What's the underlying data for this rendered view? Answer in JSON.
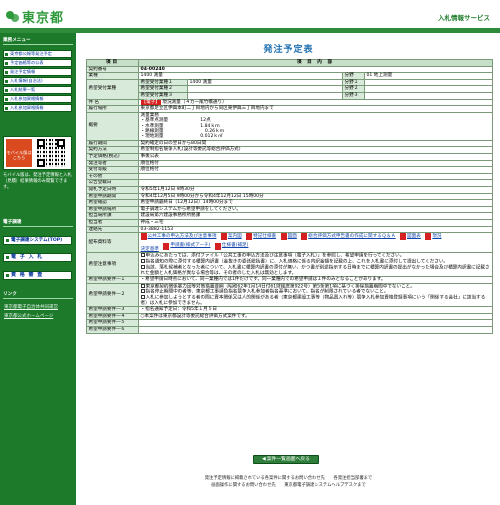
{
  "header": {
    "logo": "東京都",
    "service": "入札情報サービス"
  },
  "sidebar": {
    "menu_heading": "業務メニュー",
    "links": [
      "東京都公報等発注予定",
      "予定価格等の公表",
      "発注予定情報",
      "入札情報(自治法)",
      "入札結果一覧",
      "入札参加資格情報",
      "入札参加資格情報"
    ],
    "mobile_label": "モバイル版はこちら",
    "mobile_note": "モバイル版は、発注予定情報と入札（見積）結果情報のみ閲覧できます。",
    "system_heading": "電子調達",
    "system_links": [
      "電子調達システム(TOP)",
      "電 子 入 札",
      "資 格 審 査"
    ],
    "link_heading": "リンク",
    "plain_links": [
      "東京都電子自治体共同運営",
      "東京都公式ホームページ"
    ]
  },
  "page": {
    "title": "発注予定表"
  },
  "table": {
    "headers": [
      "項目",
      "項 目 内 容"
    ],
    "contract_no_label": "契約番号",
    "contract_no": "04-00240",
    "work_label": "業種",
    "work": "1400 測量",
    "bunya_label": "分野",
    "bunya": "01 地上測量",
    "sub_label": "希望受付業種",
    "sub_items": [
      {
        "label": "希望受付業種１",
        "value": "1400 測量",
        "bunya_label": "分野１",
        "bunya": ""
      },
      {
        "label": "希望受付業種２",
        "value": "",
        "bunya_label": "分野２",
        "bunya": ""
      },
      {
        "label": "希望受付業種３",
        "value": "",
        "bunya_label": "分野３",
        "bunya": ""
      }
    ],
    "case_label": "件 名",
    "case_tag": "【電子】",
    "case": "現況測量（４カ一尾竹橋通り）",
    "place_label": "履行場所",
    "place": "東京都足立区伊興本町二丁目地内から同区東伊興三丁目地内まで",
    "summary_label": "概要",
    "summary_lines": [
      "測量業務",
      "・基準点測量　　　　　　　12点",
      "・水準測量　　　　　　　　1.84ｋｍ",
      "・路線測量　　　　　　　　　0.26ｋｍ",
      "・現地測量　　　　　　　　0.012ｋ㎡"
    ],
    "period_label": "履行期間",
    "period": "契約確定の日の翌日から80日間",
    "method_label": "契約方法",
    "method": "希望制指名競争入札(設計等委託等総合評価方式)",
    "budget_label": "予定価格(税込)",
    "budget": "事後公表",
    "dept_label": "発注等者",
    "dept": "順位格付",
    "accept_label": "受付等級",
    "accept": "順位格付",
    "other_label": "その他",
    "other": "",
    "area_label": "公告登載日",
    "area": "",
    "open_label": "開札予定日時",
    "open": "令和5年1月12日 9時30分",
    "apply_label": "希望申請期間",
    "apply": "令和4年12月5日 9時00分から令和4年12月12日 15時00分",
    "confirm_label": "希望確認",
    "confirm": "希望申請最終日（12月12日）14時00分まで",
    "apply_place_label": "希望申請場所",
    "apply_place": "電子調達システムから希望申請をしてください。",
    "office_label": "担当局所課",
    "office": "建設局第六建設事務所所務課",
    "person_label": "担当者",
    "person": "神成・三宅",
    "tel_label": "連絡先",
    "tel": "03-3882-1153",
    "files_label": "配布資料等",
    "files": [
      "公共工事の申込方法及び注意事項",
      "案内図",
      "特記仕様書",
      "図面",
      "総合評価方式申告書の作成に関するＱ＆Ａ",
      "図面表",
      "現況",
      "決定基準",
      "申請書(様式アーチ)",
      "仕様書(補足)"
    ],
    "notes1_label": "希望注意事項",
    "notes1": [
      "申込みにあたっては、添付ファイル「公共工事の申込方法及び注意事項（電子入札）」を参照し、希望申請を行ってください。",
      "指名通知の際に添付する積算内訳書（金抜きの委託総括書）に、入札価格に係る内訳金額を記載の上、これを入札書に添付して提出してください。",
      "当該、落札候補者となった者について、入札書に積算内訳書の添付が無い、かつ書が別途指示する日時までに積算内訳書の提出がなかった場合及び積算内訳書に記載された金額と入札価格が異なる場合等は、その者のした入札は無効とします。"
    ],
    "notes2_label": "希望申請要件―１",
    "notes2": "・希望申請日時点において、同一業種内では1件だけです。同一業種内での希望申請は１件のみとなることがあります。",
    "notes3_label": "希望申請要件―２",
    "notes3": [
      "東京都契約関係暴力団等対策措置要綱（昭和62年1月14日付61財経庶第922号）第5条第1項に基づく排除措置期間中でないこと。",
      "指名停止期間中の者等、東京都工事請負指名競争入札参加者指名基準において、指名が制限されている者でないこと。",
      "入札に参加しようとする者の間に資本関係又は人的関係がある者（東京都建設工事等（物品買入れ等）競争入札参加資格登録事項にいう「関係する会社」に該当する者）は入札に参加できません。"
    ],
    "notes4_label": "希望申請要件―３",
    "notes4": "・指名通知予定日：令和5年１月５日",
    "notes5_label": "希望申請要件―４",
    "notes5": "○本案件は東京都設計等委託総合評価方式案件です。",
    "notes6_label": "希望申請要件―５",
    "notes6": "",
    "notes7_label": "希望申請要件―６",
    "notes7": ""
  },
  "back_button": "案件一覧画面へ戻る",
  "footer": {
    "line1": "発注予定情報に掲載されている各案件に関するお問い合わせ先　　各発注担当部署まで",
    "line2": "画面操作に関するお問い合わせ先　　東京都電子調達システムヘルプデスクまで"
  }
}
